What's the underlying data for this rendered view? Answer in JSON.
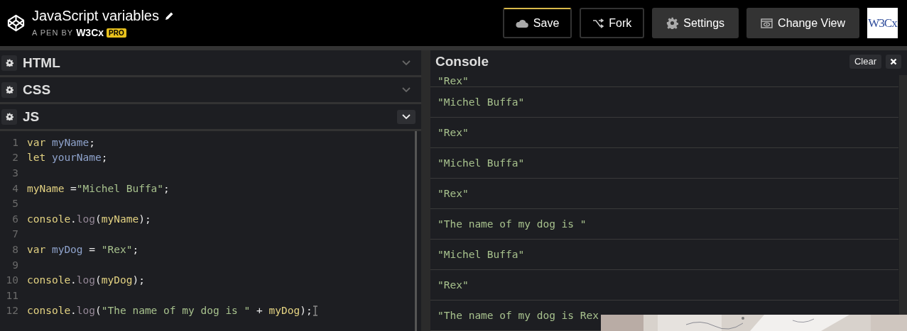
{
  "header": {
    "title": "JavaScript variables",
    "byline": "A PEN BY",
    "author": "W3Cx",
    "badge": "PRO",
    "buttons": [
      {
        "label": "Save",
        "kind": "outline",
        "highlighted": true
      },
      {
        "label": "Fork",
        "kind": "outline",
        "highlighted": false
      },
      {
        "label": "Settings",
        "kind": "filled",
        "highlighted": false
      },
      {
        "label": "Change View",
        "kind": "filled",
        "highlighted": false
      }
    ],
    "logo_text": "W3Cx"
  },
  "editors": [
    {
      "label": "HTML",
      "expanded": false
    },
    {
      "label": "CSS",
      "expanded": false
    },
    {
      "label": "JS",
      "expanded": true
    }
  ],
  "code": [
    {
      "number": "1",
      "tokens": [
        {
          "text": "var",
          "kind": "keyword"
        },
        {
          "text": " myName",
          "kind": "variable"
        },
        {
          "text": ";",
          "kind": "plain"
        }
      ]
    },
    {
      "number": "2",
      "tokens": [
        {
          "text": "let",
          "kind": "keyword"
        },
        {
          "text": " yourName",
          "kind": "variable"
        },
        {
          "text": ";",
          "kind": "plain"
        }
      ]
    },
    {
      "number": "3"
    },
    {
      "number": "4",
      "tokens": [
        {
          "text": "myName",
          "kind": "keyword"
        },
        {
          "text": " =",
          "kind": "plain"
        },
        {
          "text": "\"Michel Buffa\"",
          "kind": "string"
        },
        {
          "text": ";",
          "kind": "plain"
        }
      ]
    },
    {
      "number": "5"
    },
    {
      "number": "6",
      "tokens": [
        {
          "text": "console",
          "kind": "keyword"
        },
        {
          "text": ".",
          "kind": "plain"
        },
        {
          "text": "log",
          "kind": "method"
        },
        {
          "text": "(",
          "kind": "plain"
        },
        {
          "text": "myName",
          "kind": "keyword"
        },
        {
          "text": ");",
          "kind": "plain"
        }
      ]
    },
    {
      "number": "7"
    },
    {
      "number": "8",
      "tokens": [
        {
          "text": "var",
          "kind": "keyword"
        },
        {
          "text": " myDog",
          "kind": "variable"
        },
        {
          "text": " = ",
          "kind": "plain"
        },
        {
          "text": "\"Rex\"",
          "kind": "string"
        },
        {
          "text": ";",
          "kind": "plain"
        }
      ]
    },
    {
      "number": "9"
    },
    {
      "number": "10",
      "tokens": [
        {
          "text": "console",
          "kind": "keyword"
        },
        {
          "text": ".",
          "kind": "plain"
        },
        {
          "text": "log",
          "kind": "method"
        },
        {
          "text": "(",
          "kind": "plain"
        },
        {
          "text": "myDog",
          "kind": "keyword"
        },
        {
          "text": ");",
          "kind": "plain"
        }
      ]
    },
    {
      "number": "11"
    },
    {
      "number": "12",
      "tokens": [
        {
          "text": "console",
          "kind": "keyword"
        },
        {
          "text": ".",
          "kind": "plain"
        },
        {
          "text": "log",
          "kind": "method"
        },
        {
          "text": "(",
          "kind": "plain"
        },
        {
          "text": "\"The name of my dog is \"",
          "kind": "string"
        },
        {
          "text": " + ",
          "kind": "plain"
        },
        {
          "text": "myDog",
          "kind": "keyword"
        },
        {
          "text": ");",
          "kind": "plain"
        }
      ],
      "cursor": true
    }
  ],
  "console": {
    "title": "Console",
    "clear": "Clear",
    "entries": [
      "\"Rex\"",
      "\"Michel Buffa\"",
      "\"Rex\"",
      "\"Michel Buffa\"",
      "\"Rex\"",
      "\"The name of my dog is \"",
      "\"Michel Buffa\"",
      "\"Rex\"",
      "\"The name of my dog is Rex"
    ]
  }
}
